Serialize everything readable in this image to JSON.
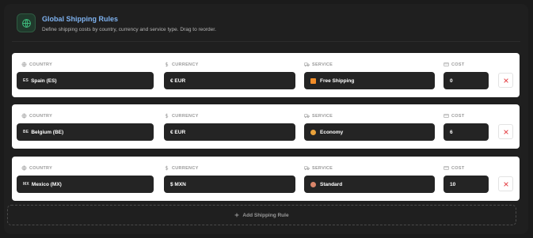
{
  "header": {
    "title": "Global Shipping Rules",
    "subtitle": "Define shipping costs by country, currency and service type. Drag to reorder."
  },
  "labels": {
    "country": "COUNTRY",
    "currency": "CURRENCY",
    "service": "SERVICE",
    "cost": "COST"
  },
  "rules": [
    {
      "flag": "ES",
      "country": "Spain (ES)",
      "currency": "€ EUR",
      "service": "Free Shipping",
      "service_icon_color": "#f28c28",
      "cost": "0"
    },
    {
      "flag": "BE",
      "country": "Belgium (BE)",
      "currency": "€ EUR",
      "service": "Economy",
      "service_icon_color": "#e9a23b",
      "cost": "6"
    },
    {
      "flag": "MX",
      "country": "Mexico (MX)",
      "currency": "$ MXN",
      "service": "Standard",
      "service_icon_color": "#d9856a",
      "cost": "10"
    }
  ],
  "add_rule_label": "Add Shipping Rule",
  "colors": {
    "accent_title": "#7eb2f0",
    "delete_icon": "#e5484d",
    "globe_badge": "#3fbf7f"
  },
  "icons": {
    "header": "globe-icon",
    "country": "globe-icon",
    "currency": "dollar-icon",
    "service": "truck-icon",
    "cost": "wallet-icon",
    "delete": "close-icon",
    "add": "plus-icon"
  }
}
